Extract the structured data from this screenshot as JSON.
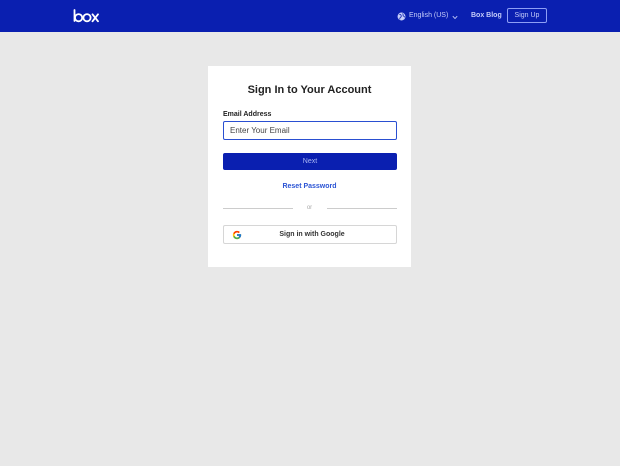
{
  "header": {
    "logo_text": "box",
    "language_label": "English (US)",
    "blog_label": "Box Blog",
    "signup_label": "Sign Up"
  },
  "login": {
    "title": "Sign In to Your Account",
    "email_label": "Email Address",
    "email_placeholder": "Enter Your Email",
    "next_label": "Next",
    "reset_label": "Reset Password",
    "divider_text": "or",
    "google_label": "Sign in with Google"
  },
  "icons": {
    "logo": "box-logo-icon",
    "language": "globe-icon",
    "dropdown": "chevron-down-icon",
    "google": "google-icon"
  },
  "colors": {
    "brand_blue": "#0a1fb0",
    "link_blue": "#2b54d4",
    "background": "#e8e8e8"
  }
}
